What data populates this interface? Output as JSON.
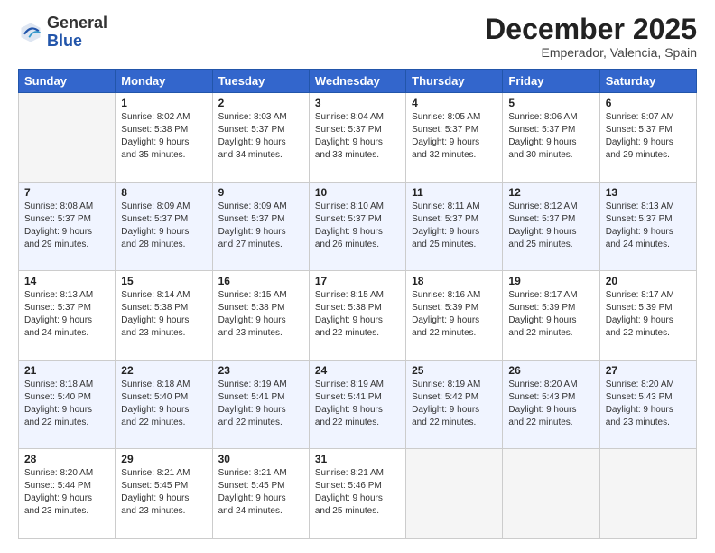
{
  "logo": {
    "general": "General",
    "blue": "Blue"
  },
  "header": {
    "month": "December 2025",
    "location": "Emperador, Valencia, Spain"
  },
  "days_of_week": [
    "Sunday",
    "Monday",
    "Tuesday",
    "Wednesday",
    "Thursday",
    "Friday",
    "Saturday"
  ],
  "weeks": [
    [
      {
        "day": "",
        "info": ""
      },
      {
        "day": "1",
        "info": "Sunrise: 8:02 AM\nSunset: 5:38 PM\nDaylight: 9 hours\nand 35 minutes."
      },
      {
        "day": "2",
        "info": "Sunrise: 8:03 AM\nSunset: 5:37 PM\nDaylight: 9 hours\nand 34 minutes."
      },
      {
        "day": "3",
        "info": "Sunrise: 8:04 AM\nSunset: 5:37 PM\nDaylight: 9 hours\nand 33 minutes."
      },
      {
        "day": "4",
        "info": "Sunrise: 8:05 AM\nSunset: 5:37 PM\nDaylight: 9 hours\nand 32 minutes."
      },
      {
        "day": "5",
        "info": "Sunrise: 8:06 AM\nSunset: 5:37 PM\nDaylight: 9 hours\nand 30 minutes."
      },
      {
        "day": "6",
        "info": "Sunrise: 8:07 AM\nSunset: 5:37 PM\nDaylight: 9 hours\nand 29 minutes."
      }
    ],
    [
      {
        "day": "7",
        "info": "Sunrise: 8:08 AM\nSunset: 5:37 PM\nDaylight: 9 hours\nand 29 minutes."
      },
      {
        "day": "8",
        "info": "Sunrise: 8:09 AM\nSunset: 5:37 PM\nDaylight: 9 hours\nand 28 minutes."
      },
      {
        "day": "9",
        "info": "Sunrise: 8:09 AM\nSunset: 5:37 PM\nDaylight: 9 hours\nand 27 minutes."
      },
      {
        "day": "10",
        "info": "Sunrise: 8:10 AM\nSunset: 5:37 PM\nDaylight: 9 hours\nand 26 minutes."
      },
      {
        "day": "11",
        "info": "Sunrise: 8:11 AM\nSunset: 5:37 PM\nDaylight: 9 hours\nand 25 minutes."
      },
      {
        "day": "12",
        "info": "Sunrise: 8:12 AM\nSunset: 5:37 PM\nDaylight: 9 hours\nand 25 minutes."
      },
      {
        "day": "13",
        "info": "Sunrise: 8:13 AM\nSunset: 5:37 PM\nDaylight: 9 hours\nand 24 minutes."
      }
    ],
    [
      {
        "day": "14",
        "info": "Sunrise: 8:13 AM\nSunset: 5:37 PM\nDaylight: 9 hours\nand 24 minutes."
      },
      {
        "day": "15",
        "info": "Sunrise: 8:14 AM\nSunset: 5:38 PM\nDaylight: 9 hours\nand 23 minutes."
      },
      {
        "day": "16",
        "info": "Sunrise: 8:15 AM\nSunset: 5:38 PM\nDaylight: 9 hours\nand 23 minutes."
      },
      {
        "day": "17",
        "info": "Sunrise: 8:15 AM\nSunset: 5:38 PM\nDaylight: 9 hours\nand 22 minutes."
      },
      {
        "day": "18",
        "info": "Sunrise: 8:16 AM\nSunset: 5:39 PM\nDaylight: 9 hours\nand 22 minutes."
      },
      {
        "day": "19",
        "info": "Sunrise: 8:17 AM\nSunset: 5:39 PM\nDaylight: 9 hours\nand 22 minutes."
      },
      {
        "day": "20",
        "info": "Sunrise: 8:17 AM\nSunset: 5:39 PM\nDaylight: 9 hours\nand 22 minutes."
      }
    ],
    [
      {
        "day": "21",
        "info": "Sunrise: 8:18 AM\nSunset: 5:40 PM\nDaylight: 9 hours\nand 22 minutes."
      },
      {
        "day": "22",
        "info": "Sunrise: 8:18 AM\nSunset: 5:40 PM\nDaylight: 9 hours\nand 22 minutes."
      },
      {
        "day": "23",
        "info": "Sunrise: 8:19 AM\nSunset: 5:41 PM\nDaylight: 9 hours\nand 22 minutes."
      },
      {
        "day": "24",
        "info": "Sunrise: 8:19 AM\nSunset: 5:41 PM\nDaylight: 9 hours\nand 22 minutes."
      },
      {
        "day": "25",
        "info": "Sunrise: 8:19 AM\nSunset: 5:42 PM\nDaylight: 9 hours\nand 22 minutes."
      },
      {
        "day": "26",
        "info": "Sunrise: 8:20 AM\nSunset: 5:43 PM\nDaylight: 9 hours\nand 22 minutes."
      },
      {
        "day": "27",
        "info": "Sunrise: 8:20 AM\nSunset: 5:43 PM\nDaylight: 9 hours\nand 23 minutes."
      }
    ],
    [
      {
        "day": "28",
        "info": "Sunrise: 8:20 AM\nSunset: 5:44 PM\nDaylight: 9 hours\nand 23 minutes."
      },
      {
        "day": "29",
        "info": "Sunrise: 8:21 AM\nSunset: 5:45 PM\nDaylight: 9 hours\nand 23 minutes."
      },
      {
        "day": "30",
        "info": "Sunrise: 8:21 AM\nSunset: 5:45 PM\nDaylight: 9 hours\nand 24 minutes."
      },
      {
        "day": "31",
        "info": "Sunrise: 8:21 AM\nSunset: 5:46 PM\nDaylight: 9 hours\nand 25 minutes."
      },
      {
        "day": "",
        "info": ""
      },
      {
        "day": "",
        "info": ""
      },
      {
        "day": "",
        "info": ""
      }
    ]
  ]
}
